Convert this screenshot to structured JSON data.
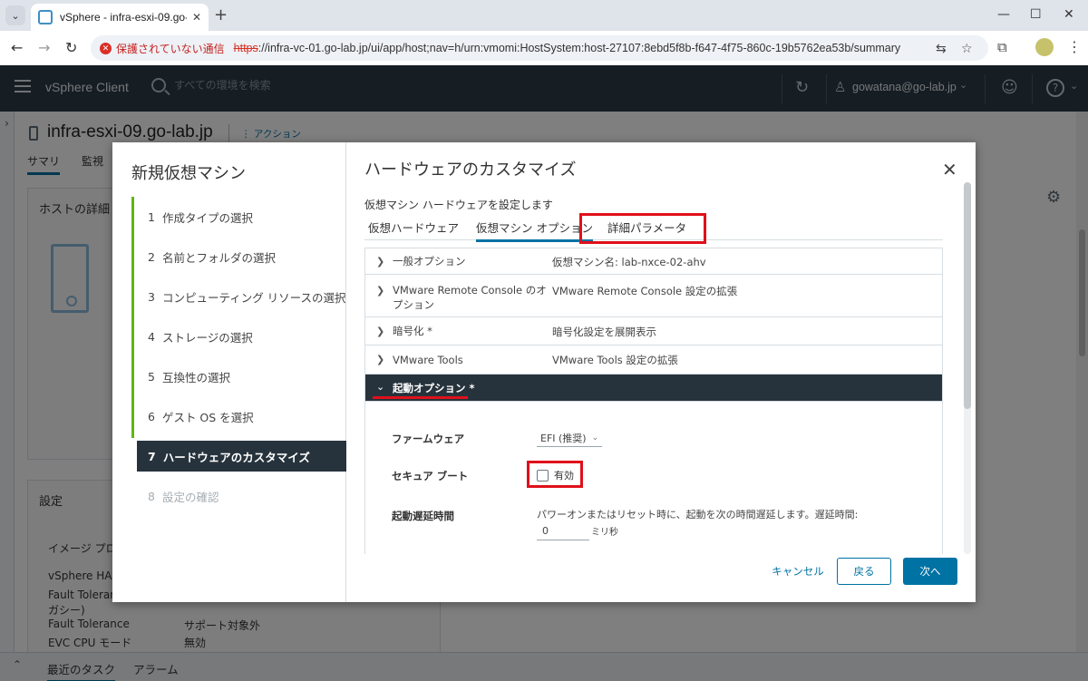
{
  "browser": {
    "tab_title": "vSphere - infra-esxi-09.go-lab.jp",
    "security_label": "保護されていない通信",
    "url_scheme": "https",
    "url_rest": "://infra-vc-01.go-lab.jp/ui/app/host;nav=h/urn:vmomi:HostSystem:host-27107:8ebd5f8b-f647-4f75-860c-19b5762ea53b/summary"
  },
  "vsphere": {
    "product_name": "vSphere Client",
    "search_placeholder": "すべての環境を検索",
    "user": "gowatana@go-lab.jp"
  },
  "background": {
    "host_name": "infra-esxi-09.go-lab.jp",
    "actions_label": "アクション",
    "tabs": [
      "サマリ",
      "監視"
    ],
    "host_details_title": "ホストの詳細",
    "settings_title": "設定",
    "settings_rows": [
      {
        "label": "イメージ プロ",
        "value": ""
      },
      {
        "label": "vSphere HA",
        "value": ""
      },
      {
        "label": "Fault Toleran",
        "value": ""
      },
      {
        "label": "ガシー)",
        "value": ""
      },
      {
        "label": "Fault Tolerance",
        "value": "サポート対象外"
      },
      {
        "label": "EVC CPU モード",
        "value": "無効"
      }
    ],
    "bottom_tabs": [
      "最近のタスク",
      "アラーム"
    ]
  },
  "wizard": {
    "title": "新規仮想マシン",
    "steps": [
      {
        "num": "1",
        "label": "作成タイプの選択",
        "state": "done"
      },
      {
        "num": "2",
        "label": "名前とフォルダの選択",
        "state": "done"
      },
      {
        "num": "3",
        "label": "コンピューティング リソースの選択",
        "state": "done"
      },
      {
        "num": "4",
        "label": "ストレージの選択",
        "state": "done"
      },
      {
        "num": "5",
        "label": "互換性の選択",
        "state": "done"
      },
      {
        "num": "6",
        "label": "ゲスト OS を選択",
        "state": "done"
      },
      {
        "num": "7",
        "label": "ハードウェアのカスタマイズ",
        "state": "active"
      },
      {
        "num": "8",
        "label": "設定の確認",
        "state": "disabled"
      }
    ],
    "content_title": "ハードウェアのカスタマイズ",
    "content_subtitle": "仮想マシン ハードウェアを設定します",
    "tabs": [
      {
        "label": "仮想ハードウェア",
        "active": false
      },
      {
        "label": "仮想マシン オプション",
        "active": true
      },
      {
        "label": "詳細パラメータ",
        "active": false
      }
    ],
    "sections": [
      {
        "label": "一般オプション",
        "value": "仮想マシン名: lab-nxce-02-ahv"
      },
      {
        "label": "VMware Remote Console のオプション",
        "value": "VMware Remote Console 設定の拡張"
      },
      {
        "label": "暗号化 *",
        "value": "暗号化設定を展開表示"
      },
      {
        "label": "VMware Tools",
        "value": "VMware Tools 設定の拡張"
      },
      {
        "label": "起動オプション *",
        "value": ""
      }
    ],
    "boot": {
      "firmware_label": "ファームウェア",
      "firmware_value": "EFI (推奨)",
      "secure_boot_label": "セキュア ブート",
      "secure_boot_checkbox": "有効",
      "secure_boot_checked": false,
      "delay_label": "起動遅延時間",
      "delay_desc": "パワーオンまたはリセット時に、起動を次の時間遅延します。遅延時間:",
      "delay_value": "0",
      "delay_unit": "ミリ秒"
    },
    "buttons": {
      "cancel": "キャンセル",
      "back": "戻る",
      "next": "次へ"
    }
  },
  "colors": {
    "accent": "#0072a3",
    "header_bg": "#2d3b46",
    "active_step_bg": "#27333c",
    "progress_rail": "#60b515",
    "highlight": "#e0101a"
  },
  "icons": [
    "tab-list-icon",
    "favicon-icon",
    "close-icon",
    "plus-icon",
    "back-icon",
    "forward-icon",
    "reload-icon",
    "translate-icon",
    "star-icon",
    "extensions-icon",
    "profile-icon",
    "more-icon",
    "hamburger-icon",
    "search-icon",
    "refresh-icon",
    "user-icon",
    "feedback-icon",
    "help-icon",
    "host-icon",
    "gear-icon",
    "chevron-right-icon",
    "chevron-down-icon"
  ]
}
